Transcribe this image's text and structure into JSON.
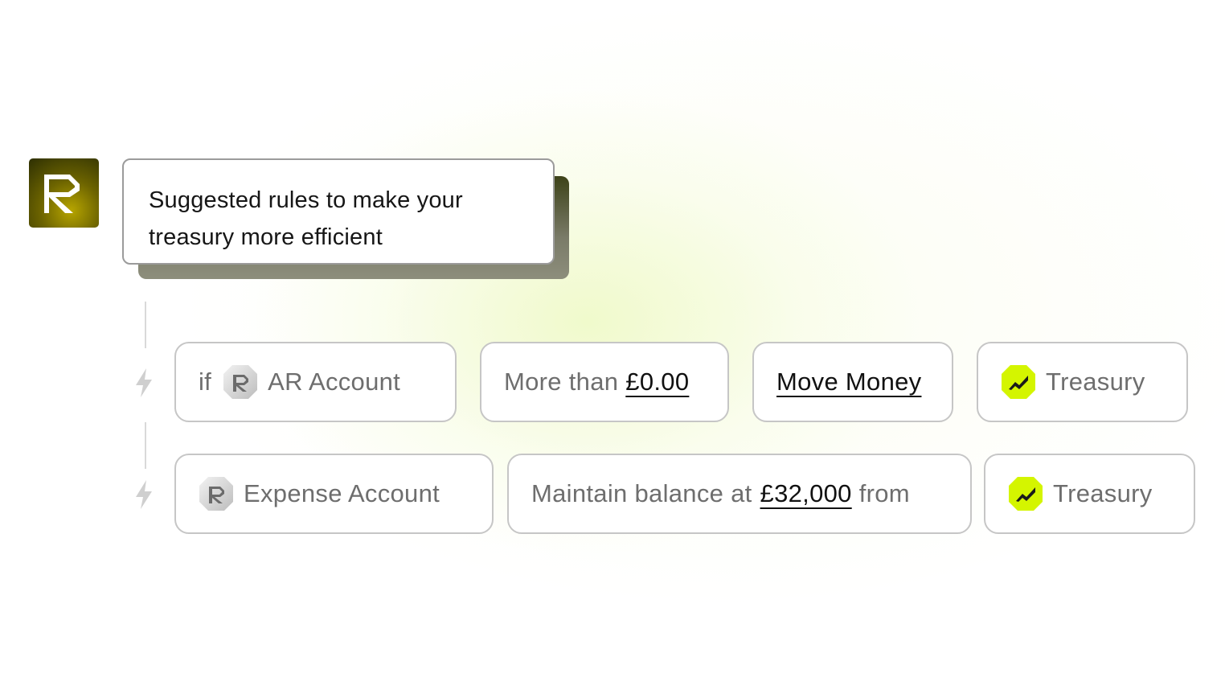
{
  "header": {
    "message_line1": "Suggested rules to make your",
    "message_line2": "treasury more efficient"
  },
  "rules": [
    {
      "trigger": {
        "prefix": "if",
        "account": "AR Account",
        "icon": "r-logo-icon"
      },
      "condition": {
        "text": "More than",
        "amount": "£0.00"
      },
      "action": {
        "label": "Move Money"
      },
      "destination": {
        "label": "Treasury",
        "icon": "treasury-chart-icon"
      }
    },
    {
      "trigger": {
        "account": "Expense Account",
        "icon": "r-logo-icon"
      },
      "condition": {
        "text": "Maintain balance at",
        "amount": "£32,000",
        "suffix": "from"
      },
      "destination": {
        "label": "Treasury",
        "icon": "treasury-chart-icon"
      }
    }
  ],
  "colors": {
    "accent": "#d4f500",
    "logo_dark": "#2d2f03",
    "logo_gold": "#b7a500",
    "border": "#c6c6c6",
    "muted_text": "#6e6e6e"
  }
}
